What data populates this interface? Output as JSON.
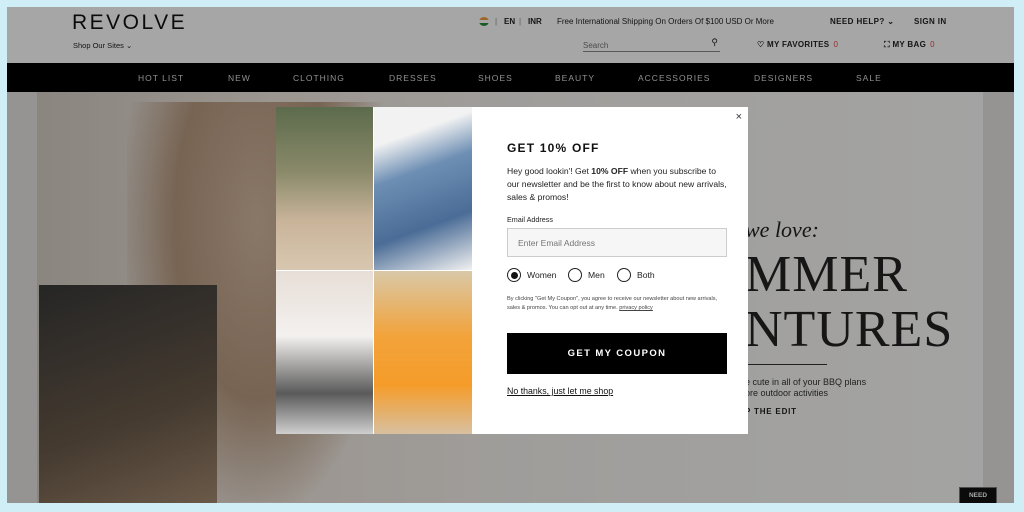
{
  "header": {
    "logo": "REVOLVE",
    "shop_sites": "Shop Our Sites ⌄",
    "language": "EN",
    "currency": "INR",
    "separator": "|",
    "shipping": "Free International Shipping On Orders Of $100 USD Or More",
    "need_help": "NEED HELP? ⌄",
    "sign_in": "SIGN IN",
    "search_placeholder": "Search",
    "favorites_label": "MY FAVORITES",
    "favorites_count": "0",
    "bag_label": "MY BAG",
    "bag_count": "0"
  },
  "nav": {
    "items": [
      "HOT LIST",
      "NEW",
      "CLOTHING",
      "DRESSES",
      "SHOES",
      "BEAUTY",
      "ACCESSORIES",
      "DESIGNERS",
      "SALE"
    ]
  },
  "hero": {
    "tagline": "we love:",
    "headline_line1": "MMER",
    "headline_line2": "NTURES",
    "sub_line1": "e cute in all of your BBQ plans",
    "sub_line2": "ore outdoor activities",
    "cta": "P THE EDIT",
    "need": "NEED"
  },
  "modal": {
    "close": "×",
    "title": "GET 10% OFF",
    "body_prefix": "Hey good lookin'! Get ",
    "body_bold": "10% OFF",
    "body_suffix": " when you subscribe to our newsletter and be the first to know about new arrivals, sales & promos!",
    "email_label": "Email Address",
    "email_placeholder": "Enter Email Address",
    "options": [
      "Women",
      "Men",
      "Both"
    ],
    "selected": "Women",
    "fine_print": "By clicking \"Get My Coupon\", you agree to receive our newsletter about new arrivals, sales & promos. You can opt out at any time.",
    "privacy": "privacy policy",
    "cta": "GET MY COUPON",
    "no_thanks": "No thanks, just let me shop"
  }
}
